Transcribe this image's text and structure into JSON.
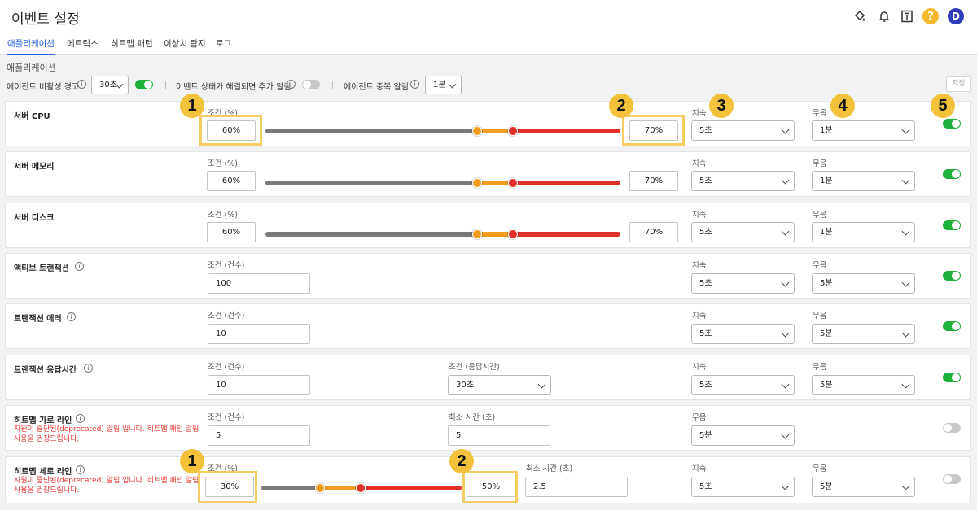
{
  "page_title": "이벤트 설정",
  "tabs": [
    "애플리케이션",
    "메트릭스",
    "히트맵 패턴",
    "이상치 탐지",
    "로그"
  ],
  "section_title": "애플리케이션",
  "global": {
    "inactive_label": "에이전트 비활성 경고",
    "inactive_value": "30초",
    "resolved_label": "이벤트 상태가 해결되면 추가 알림",
    "dup_label": "에이전트 중복 알림",
    "dup_value": "1분",
    "save_label": "저장"
  },
  "colors": {
    "accent": "#2a67d6",
    "toggle_on": "#1fb23a",
    "warning_text": "#e53935",
    "callout": "#f3c23a",
    "bar_gray": "#7a7a7a",
    "bar_orange": "#f39c1f",
    "bar_red": "#e0302a"
  },
  "rows": [
    {
      "name": "서버 CPU",
      "cond_label": "조건 (%)",
      "low": "60%",
      "high": "70%",
      "dur_label": "지속",
      "dur": "5초",
      "mute_label": "무음",
      "mute": "1분",
      "enabled": true
    },
    {
      "name": "서버 메모리",
      "cond_label": "조건 (%)",
      "low": "60%",
      "high": "70%",
      "dur_label": "지속",
      "dur": "5초",
      "mute_label": "무음",
      "mute": "1분",
      "enabled": true
    },
    {
      "name": "서버 디스크",
      "cond_label": "조건 (%)",
      "low": "60%",
      "high": "70%",
      "dur_label": "지속",
      "dur": "5초",
      "mute_label": "무음",
      "mute": "1분",
      "enabled": true
    },
    {
      "name": "액티브 트랜잭션",
      "cond_label": "조건 (건수)",
      "value": "100",
      "dur_label": "지속",
      "dur": "5초",
      "mute_label": "무음",
      "mute": "5분",
      "enabled": true
    },
    {
      "name": "트랜잭션 에러",
      "cond_label": "조건 (건수)",
      "value": "10",
      "dur_label": "지속",
      "dur": "5초",
      "mute_label": "무음",
      "mute": "5분",
      "enabled": true
    },
    {
      "name": "트랜잭션 응답시간",
      "cond_label": "조건 (건수)",
      "value": "10",
      "resp_label": "조건 (응답시간)",
      "resp": "30초",
      "dur_label": "지속",
      "dur": "5초",
      "mute_label": "무음",
      "mute": "5분",
      "enabled": true
    },
    {
      "name": "히트맵 가로 라인",
      "warning": "지원이 중단된(deprecated) 알림 입니다. 히트맵 패턴 알림 사용을 권장드립니다.",
      "cond_label": "조건 (건수)",
      "value": "5",
      "min_label": "최소 시간 (초)",
      "min": "5",
      "mute_label": "무음",
      "mute": "5분",
      "enabled": false
    },
    {
      "name": "히트맵 세로 라인",
      "warning": "지원이 중단된(deprecated) 알림 입니다. 히트맵 패턴 알림 사용을 권장드립니다.",
      "cond_label": "조건 (%)",
      "low": "30%",
      "high": "50%",
      "min_label": "최소 시간 (초)",
      "min": "2.5",
      "dur_label": "지속",
      "dur": "5초",
      "mute_label": "무음",
      "mute": "5분",
      "enabled": false
    }
  ],
  "callouts": [
    "1",
    "2",
    "3",
    "4",
    "5",
    "1",
    "2"
  ]
}
